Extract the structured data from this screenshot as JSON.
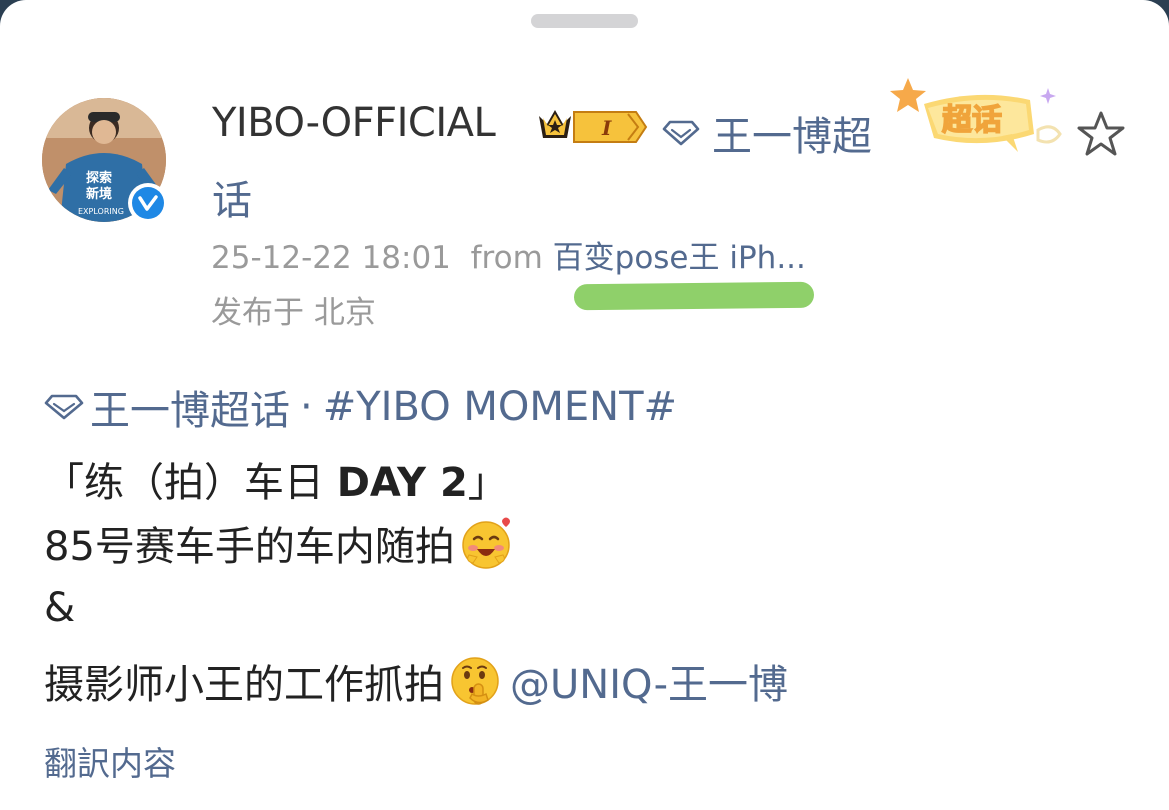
{
  "grabber": "sheet-handle",
  "post": {
    "author": {
      "username": "YIBO-OFFICIAL",
      "avatar_text": [
        "探索",
        "新境",
        "EXPLORING"
      ],
      "verified": true,
      "level_badge": "I"
    },
    "header_topic": {
      "line1": "王一博超",
      "line2": "话"
    },
    "sticker_label": "超话",
    "meta": {
      "timestamp": "25-12-22 18:01",
      "from_word": "from",
      "source": "百变pose王 iPh...",
      "location": "发布于 北京"
    },
    "content": {
      "topic": "王一博超话",
      "separator": "·",
      "hashtag": "#YIBO MOMENT#",
      "line2_open": "「练（拍）车日 ",
      "line2_bold": "DAY 2",
      "line2_close": "」",
      "line3": "85号赛车手的车内随拍",
      "line3_emoji": "blush-love-emoji",
      "line4": "&",
      "line5": "摄影师小王的工作抓拍",
      "line5_emoji": "shush-emoji",
      "mention": "@UNIQ-王一博"
    },
    "translate_label": "翻訳内容"
  },
  "colors": {
    "link": "#536a8f",
    "text": "#222222",
    "meta": "#9a9a9a",
    "verified": "#1e88e5",
    "highlight": "#8fd06a"
  }
}
